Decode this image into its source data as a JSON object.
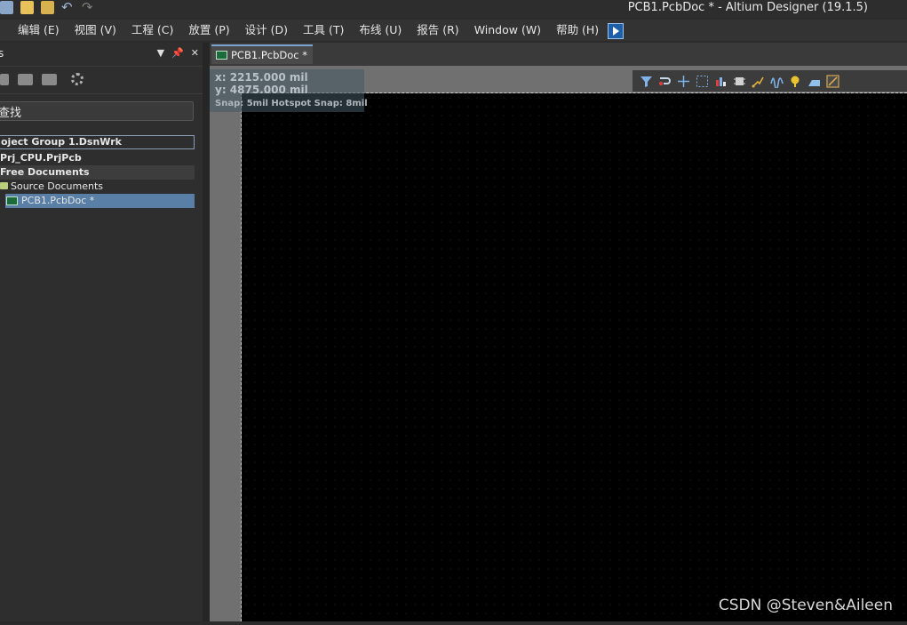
{
  "window": {
    "title": "PCB1.PcbDoc * - Altium Designer (19.1.5)"
  },
  "menu": {
    "items": [
      "编辑 (E)",
      "视图 (V)",
      "工程 (C)",
      "放置 (P)",
      "设计 (D)",
      "工具 (T)",
      "布线 (U)",
      "报告 (R)",
      "Window (W)",
      "帮助 (H)"
    ]
  },
  "panel": {
    "title": "s",
    "search_placeholder": "查找",
    "tree": {
      "group": "oject Group 1.DsnWrk",
      "project": "Prj_CPU.PrjPcb",
      "free_docs": "Free Documents",
      "source_docs": "Source Documents",
      "document": "PCB1.PcbDoc *"
    }
  },
  "doc_tab": {
    "label": "PCB1.PcbDoc *"
  },
  "canvas": {
    "x_readout": "x:  2215.000  mil",
    "y_readout": "y:  4875.000  mil",
    "snap": "Snap: 5mil Hotspot Snap: 8mil"
  },
  "colors": {
    "outline": "#ff00ff",
    "selection": "#5a7fa6"
  },
  "watermark": "CSDN @Steven&Aileen"
}
